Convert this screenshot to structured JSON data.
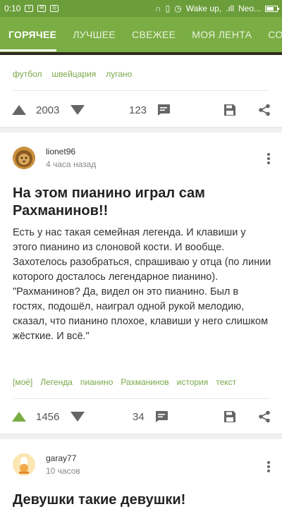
{
  "status_bar": {
    "time": "0:10",
    "right_text": "Wake up,",
    "carrier": "Neo..."
  },
  "tabs": [
    {
      "label": "ГОРЯЧЕЕ",
      "active": true
    },
    {
      "label": "ЛУЧШЕЕ",
      "active": false
    },
    {
      "label": "СВЕЖЕЕ",
      "active": false
    },
    {
      "label": "МОЯ ЛЕНТА",
      "active": false
    },
    {
      "label": "СООБЩЕ",
      "active": false
    }
  ],
  "prev_post": {
    "tags": [
      "футбол",
      "швейцария",
      "лугано"
    ],
    "rating": "2003",
    "comments": "123"
  },
  "post": {
    "author": "lionet96",
    "time": "4 часа назад",
    "title": "На этом пианино играл сам Рахманинов!!",
    "paragraphs": [
      "Есть у нас такая семейная легенда. И клавиши у этого пианино из слоновой кости. И вообще.",
      "Захотелось разобраться, спрашиваю у отца (по линии которого досталось легендарное пианино).",
      "\"Рахманинов? Да, видел он это пианино. Был в гостях, подошёл, наиграл одной рукой мелодию, сказал, что пианино плохое, клавиши у него слишком жёсткие. И всё.\""
    ],
    "tags": [
      "[моё]",
      "Легенда",
      "пианино",
      "Рахманинов",
      "история",
      "текст"
    ],
    "rating": "1456",
    "comments": "34"
  },
  "next_post": {
    "author": "garay77",
    "time": "10 часов",
    "title": "Девушки такие девушки!"
  },
  "colors": {
    "accent": "#7aad44",
    "statusbar": "#6b9e3a",
    "tag": "#79a84a",
    "icon": "#666666"
  }
}
